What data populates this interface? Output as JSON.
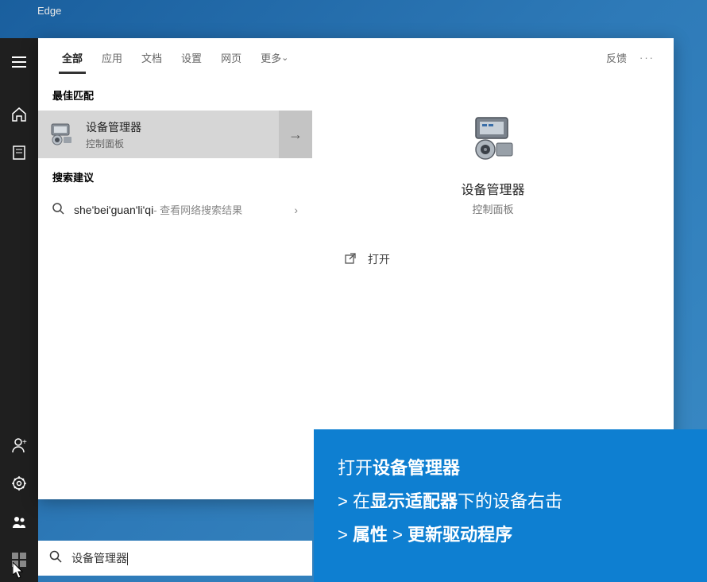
{
  "desktop": {
    "icon_label": "Edge"
  },
  "rail": {
    "items": [
      "menu",
      "home",
      "recent",
      "user",
      "settings",
      "people"
    ]
  },
  "tabs": {
    "all": "全部",
    "apps": "应用",
    "docs": "文档",
    "settings": "设置",
    "web": "网页",
    "more": "更多",
    "feedback": "反馈"
  },
  "sections": {
    "best_match": "最佳匹配",
    "suggestions": "搜索建议"
  },
  "best_match": {
    "title": "设备管理器",
    "subtitle": "控制面板"
  },
  "suggestion": {
    "text": "she'bei'guan'li'qi",
    "hint": " - 查看网络搜索结果"
  },
  "detail": {
    "title": "设备管理器",
    "subtitle": "控制面板",
    "open": "打开"
  },
  "search": {
    "value": "设备管理器"
  },
  "overlay": {
    "l1_pre": "打开",
    "l1_bold": "设备管理器",
    "l2_pre": "> 在",
    "l2_bold": "显示适配器",
    "l2_post": "下的设备右击",
    "l3_pre": "> ",
    "l3_b1": "属性",
    "l3_mid": " > ",
    "l3_b2": "更新驱动程序"
  }
}
